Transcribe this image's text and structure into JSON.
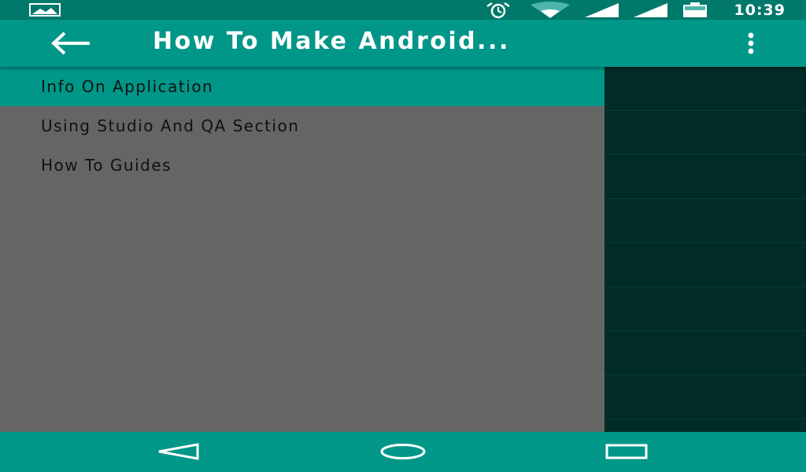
{
  "status_bar": {
    "time": "10:39",
    "icons": [
      "image-notification-icon",
      "alarm-icon",
      "wifi-icon",
      "signal-icon",
      "signal-icon",
      "battery-icon"
    ]
  },
  "app_bar": {
    "title": "How To Make Android...",
    "back_icon": "arrow-back-icon",
    "menu_icon": "more-vert-icon"
  },
  "drawer": {
    "items": [
      {
        "label": "Info On Application",
        "selected": true
      },
      {
        "label": "Using Studio And QA Section",
        "selected": false
      },
      {
        "label": "How To Guides",
        "selected": false
      }
    ]
  },
  "nav_bar": {
    "icons": [
      "back-triangle-icon",
      "home-circle-icon",
      "recents-square-icon"
    ]
  },
  "colors": {
    "primary": "#009688",
    "primary_dark": "#00796B",
    "drawer_bg": "#656565",
    "content_bg": "#002B26"
  }
}
